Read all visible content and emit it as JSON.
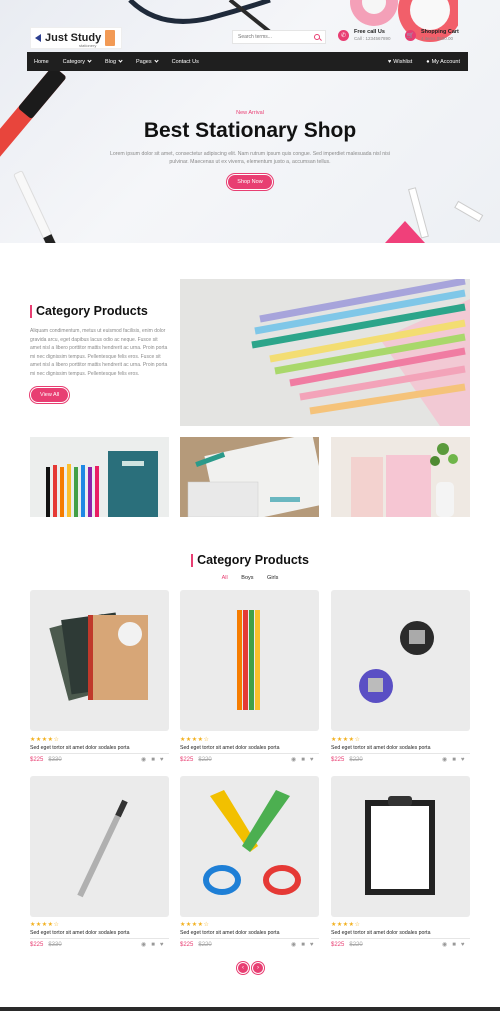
{
  "header": {
    "logo_text": "Just Study",
    "logo_sub": "stationery",
    "search_placeholder": "Search terms...",
    "call_title": "Free call Us",
    "call_number": "Call : 1234567890",
    "cart_title": "Shopping Cart",
    "cart_summary": "4 items $500.00"
  },
  "nav": {
    "items": [
      "Home",
      "Category",
      "Blog",
      "Pages",
      "Contact Us"
    ],
    "wishlist": "Wishlist",
    "account": "My Account"
  },
  "hero": {
    "eyebrow": "New Arrival",
    "title": "Best Stationary Shop",
    "description": "Lorem ipsum dolor sit amet, consectetur adipiscing elit. Nam rutrum ipsum quis congue. Sed imperdiet malesuada nisl nisi pulvinar. Maecenas ut ex viverra, elementum justo a, accumsan tellus.",
    "button": "Shop Now"
  },
  "category_intro": {
    "title": "Category Products",
    "description": "Aliquam condimentum, metus ut euismod facilisis, enim dolor gravida arcu, eget dapibus lacus odio ac neque. Fusce sit amet nisl a libero porttitor mattis hendrerit ac urna. Proin porta mi nec dignissim tempus. Pellentesque felis eros. Fusce sit amet nisl a libero porttitor mattis hendrerit ac urna. Proin porta mi nec dignissim tempus. Pellentesque felis eros.",
    "button": "View All"
  },
  "products_section": {
    "title": "Category Products",
    "tabs": [
      "All",
      "Boys",
      "Girls"
    ],
    "active_tab": "All"
  },
  "products": [
    {
      "title": "Sed eget tortor sit amet dolor sodales porta",
      "price": "$225",
      "old_price": "$330",
      "rating": 4,
      "image": "notebooks"
    },
    {
      "title": "Sed eget tortor sit amet dolor sodales porta",
      "price": "$225",
      "old_price": "$220",
      "rating": 4,
      "image": "markers"
    },
    {
      "title": "Sed eget tortor sit amet dolor sodales porta",
      "price": "$225",
      "old_price": "$220",
      "rating": 4,
      "image": "sharpeners"
    },
    {
      "title": "Sed eget tortor sit amet dolor sodales porta",
      "price": "$225",
      "old_price": "$330",
      "rating": 4,
      "image": "pencil"
    },
    {
      "title": "Sed eget tortor sit amet dolor sodales porta",
      "price": "$225",
      "old_price": "$220",
      "rating": 4,
      "image": "scissors"
    },
    {
      "title": "Sed eget tortor sit amet dolor sodales porta",
      "price": "$225",
      "old_price": "$220",
      "rating": 4,
      "image": "clipboard"
    }
  ],
  "pager": {
    "prev": "‹",
    "next": "›"
  },
  "colors": {
    "accent": "#e83e72",
    "nav_bg": "#1f1f1f",
    "star": "#f2b01e"
  },
  "icons": [
    "search-icon",
    "phone-icon",
    "cart-icon",
    "heart-icon",
    "user-icon",
    "eye-icon",
    "star-icon"
  ]
}
